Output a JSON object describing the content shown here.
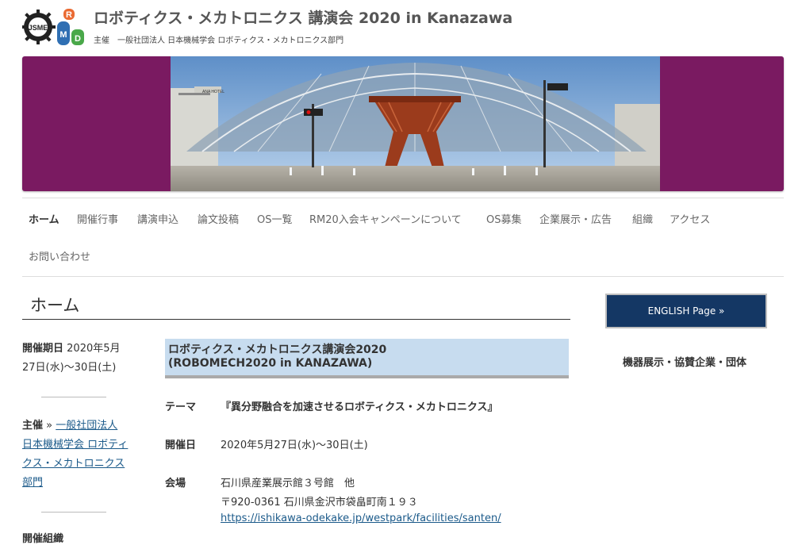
{
  "header": {
    "logo_text": "JSME",
    "logo_letters": [
      "R",
      "M",
      "D"
    ],
    "title": "ロボティクス・メカトロニクス 講演会 2020 in Kanazawa",
    "organizer_label": "主催",
    "organizer": "一般社団法人 日本機械学会 ロボティクス・メカトロニクス部門"
  },
  "banner": {
    "background": "#7a1a61",
    "hotel_sign": "ANA HOTEL"
  },
  "nav": {
    "items": [
      {
        "label": "ホーム",
        "active": true
      },
      {
        "label": "開催行事"
      },
      {
        "label": "講演申込"
      },
      {
        "label": "論文投稿"
      },
      {
        "label": "OS一覧"
      },
      {
        "label": "RM20入会キャンペーンについて"
      },
      {
        "label": "OS募集"
      },
      {
        "label": "企業展示・広告"
      },
      {
        "label": "組織"
      },
      {
        "label": "アクセス"
      },
      {
        "label": "お問い合わせ"
      }
    ]
  },
  "main": {
    "heading": "ホーム",
    "left": {
      "date_label": "開催期日",
      "date_value": "2020年5月27日(水)〜30日(土)",
      "host_label": "主催",
      "host_arrow": " » ",
      "host_link": "一般社団法人 日本機械学会 ロボティクス・メカトロニクス部門",
      "truncated_label": "開催組織"
    },
    "event": {
      "title_line1": "ロボティクス・メカトロニクス講演会2020",
      "title_line2": "(ROBOMECH2020 in KANAZAWA)",
      "theme_label": "テーマ",
      "theme_value": "『異分野融合を加速させるロボティクス・メカトロニクス』",
      "date_label": "開催日",
      "date_value": "2020年5月27日(水)〜30日(土)",
      "venue_label": "会場",
      "venue_name": "石川県産業展示館３号館　他",
      "venue_address": "〒920-0361 石川県金沢市袋畠町南１９３",
      "venue_url": "https://ishikawa-odekake.jp/westpark/facilities/santen/"
    }
  },
  "sidebar": {
    "english_button": "ENGLISH Page »",
    "sponsor_heading": "機器展示・協賛企業・団体"
  }
}
